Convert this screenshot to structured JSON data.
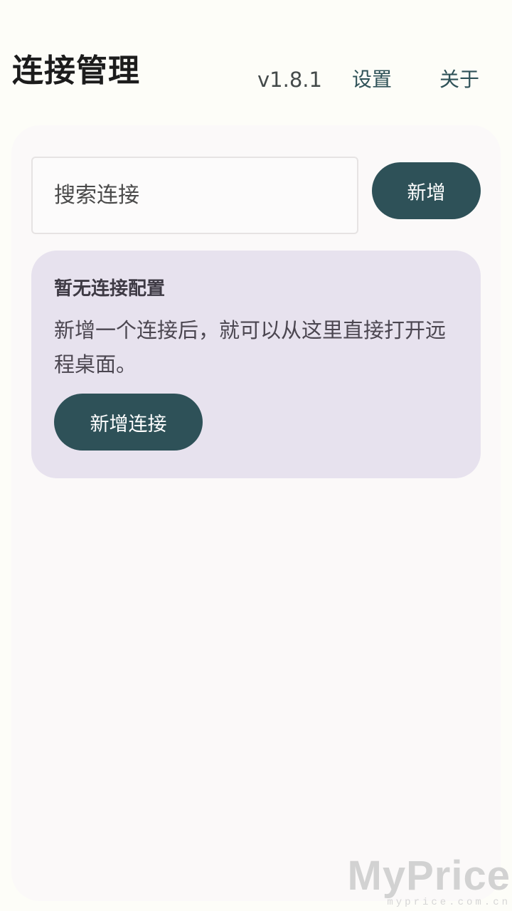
{
  "header": {
    "title": "连接管理",
    "version": "v1.8.1",
    "settings_label": "设置",
    "about_label": "关于"
  },
  "toolbar": {
    "search_placeholder": "搜索连接",
    "add_label": "新增"
  },
  "empty_state": {
    "title": "暂无连接配置",
    "description": "新增一个连接后，就可以从这里直接打开远程桌面。",
    "button_label": "新增连接"
  },
  "watermark": {
    "logo": "MyPrice",
    "url": "myprice.com.cn"
  },
  "colors": {
    "accent": "#2e5158",
    "card_background": "#e7e2ee",
    "page_background": "#fdfdf8"
  }
}
